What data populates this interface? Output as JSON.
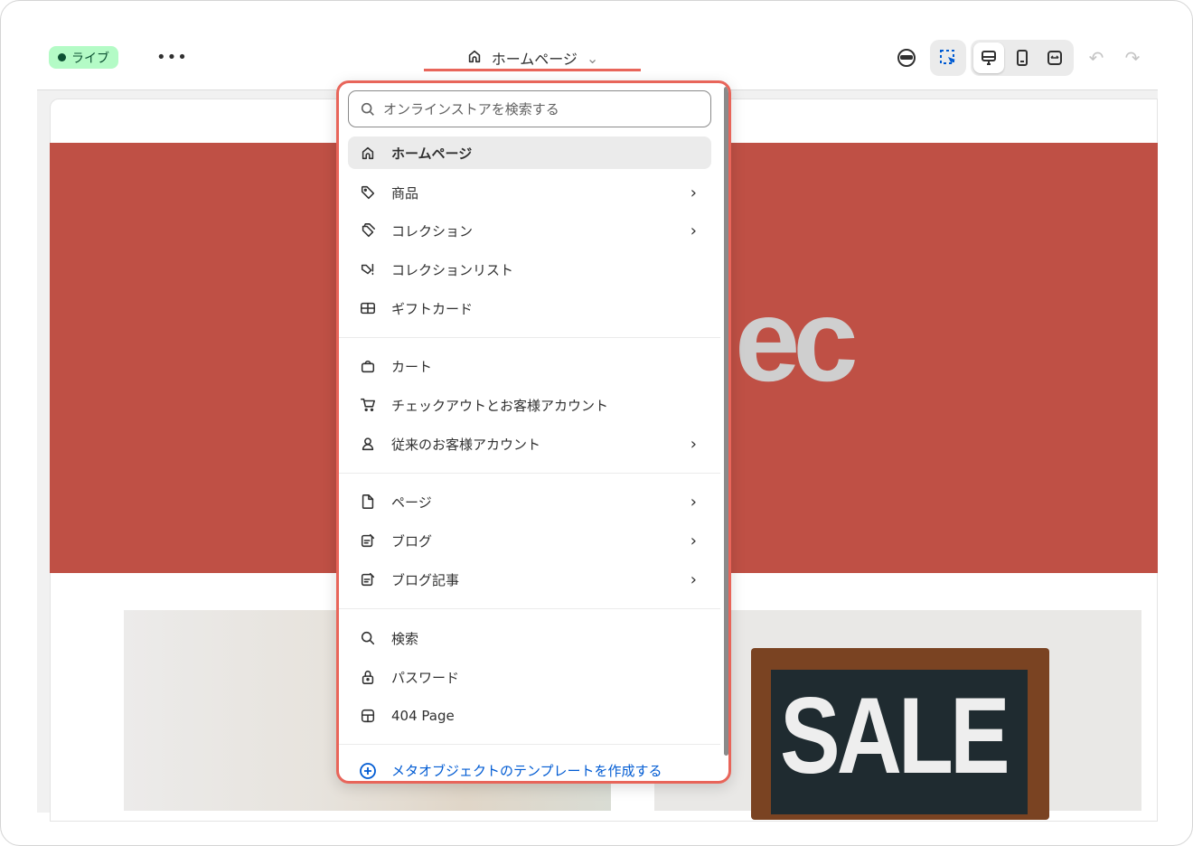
{
  "header": {
    "status_label": "ライブ",
    "more_label": "•••",
    "page_title": "ホームページ"
  },
  "canvas": {
    "logo_text": "ec",
    "sale_text": "SALE"
  },
  "dropdown": {
    "search_placeholder": "オンラインストアを検索する",
    "groups": [
      [
        {
          "label": "ホームページ",
          "icon": "home-icon",
          "chevron": false,
          "selected": true
        },
        {
          "label": "商品",
          "icon": "tag-icon",
          "chevron": true
        },
        {
          "label": "コレクション",
          "icon": "collection-icon",
          "chevron": true
        },
        {
          "label": "コレクションリスト",
          "icon": "collection-list-icon",
          "chevron": false
        },
        {
          "label": "ギフトカード",
          "icon": "gift-card-icon",
          "chevron": false
        }
      ],
      [
        {
          "label": "カート",
          "icon": "bag-icon",
          "chevron": false
        },
        {
          "label": "チェックアウトとお客様アカウント",
          "icon": "cart-icon",
          "chevron": false
        },
        {
          "label": "従来のお客様アカウント",
          "icon": "person-icon",
          "chevron": true
        }
      ],
      [
        {
          "label": "ページ",
          "icon": "page-icon",
          "chevron": true
        },
        {
          "label": "ブログ",
          "icon": "blog-icon",
          "chevron": true
        },
        {
          "label": "ブログ記事",
          "icon": "blog-post-icon",
          "chevron": true
        }
      ],
      [
        {
          "label": "検索",
          "icon": "search-icon",
          "chevron": false
        },
        {
          "label": "パスワード",
          "icon": "lock-icon",
          "chevron": false
        },
        {
          "label": "404 Page",
          "icon": "layout-icon",
          "chevron": false
        }
      ]
    ],
    "footer_label": "メタオブジェクトのテンプレートを作成する"
  },
  "colors": {
    "accent": "#e8655a",
    "banner": "#bf5045",
    "link": "#005bd3",
    "live_bg": "#b4fbc6"
  }
}
